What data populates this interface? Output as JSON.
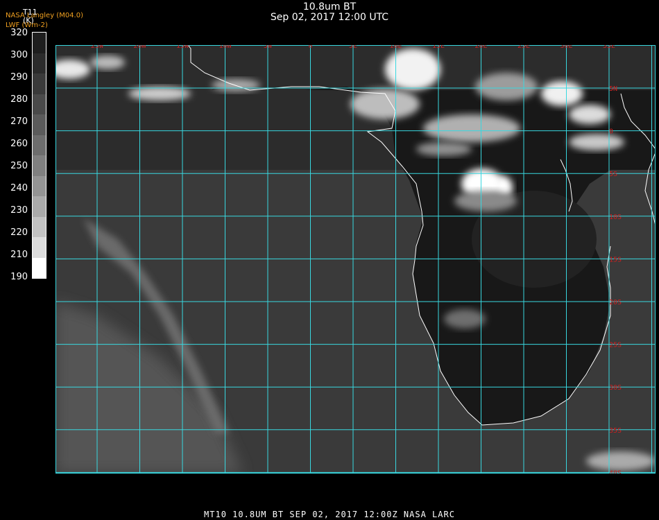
{
  "header": {
    "title": "10.8um BT",
    "subtitle": "Sep 02, 2017 12:00 UTC",
    "source_tag": "NASA Langley (M04.0)",
    "product_tag": "LWF (Wm-2)"
  },
  "colorbar": {
    "title": "T11",
    "unit": "(K)",
    "ticks": [
      "320",
      "300",
      "290",
      "280",
      "270",
      "260",
      "250",
      "240",
      "230",
      "220",
      "210",
      "190"
    ],
    "colors": [
      "#1e1e1e",
      "#2b2b2b",
      "#3a3a3a",
      "#4a4a4a",
      "#5b5b5b",
      "#6d6d6d",
      "#808080",
      "#949494",
      "#aaaaaa",
      "#c2c2c2",
      "#dcdcdc",
      "#ffffff"
    ]
  },
  "map": {
    "lon_labels": [
      "25W",
      "20W",
      "15W",
      "10W",
      "5W",
      "0",
      "5E",
      "10E",
      "15E",
      "20E",
      "25E",
      "30E",
      "35E"
    ],
    "lat_labels": [
      "5N",
      "0",
      "5S",
      "10S",
      "15S",
      "20S",
      "25S",
      "30S",
      "35S",
      "40S"
    ],
    "grid_color": "#38d8e0",
    "coast_color": "#ffffff",
    "label_color": "#cc2020"
  },
  "footer": {
    "text": "MT10  10.8UM BT   SEP 02, 2017 12:00Z   NASA LARC"
  }
}
